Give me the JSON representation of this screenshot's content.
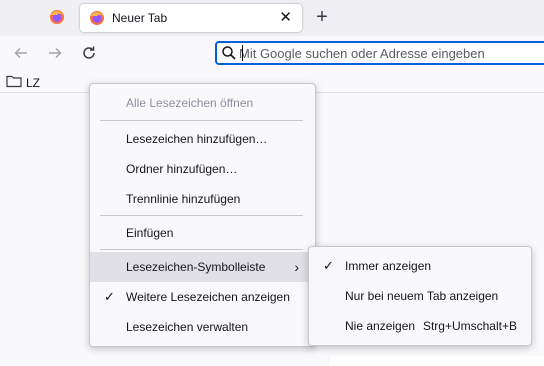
{
  "tabs": {
    "pinned_icon": "firefox-icon",
    "active": {
      "title": "Neuer Tab",
      "icon": "firefox-icon"
    },
    "new_tab_label": "+",
    "close_glyph": "✕"
  },
  "navbar": {
    "back_icon": "back-arrow-icon",
    "forward_icon": "forward-arrow-icon",
    "reload_icon": "reload-icon",
    "url_placeholder": "Mit Google suchen oder Adresse eingeben"
  },
  "bookmarks_bar": {
    "items": [
      {
        "label": "LZ",
        "icon": "folder-icon"
      }
    ]
  },
  "context_menu": {
    "items": [
      {
        "label": "Alle Lesezeichen öffnen",
        "disabled": true
      },
      {
        "label": "Lesezeichen hinzufügen…"
      },
      {
        "label": "Ordner hinzufügen…"
      },
      {
        "label": "Trennlinie hinzufügen"
      },
      {
        "label": "Einfügen"
      },
      {
        "label": "Lesezeichen-Symbolleiste",
        "submenu": true,
        "arrow": "›"
      },
      {
        "label": "Weitere Lesezeichen anzeigen",
        "checked": true
      },
      {
        "label": "Lesezeichen verwalten"
      }
    ]
  },
  "submenu": {
    "items": [
      {
        "label": "Immer anzeigen",
        "checked": true
      },
      {
        "label": "Nur bei neuem Tab anzeigen"
      },
      {
        "label": "Nie anzeigen",
        "accel": "Strg+Umschalt+B"
      }
    ]
  },
  "check_glyph": "✓",
  "colors": {
    "accent": "#0061e0",
    "menu_bg": "#f9f9fb",
    "hover": "#e0e0e6",
    "tabstrip": "#f0f0f4"
  }
}
